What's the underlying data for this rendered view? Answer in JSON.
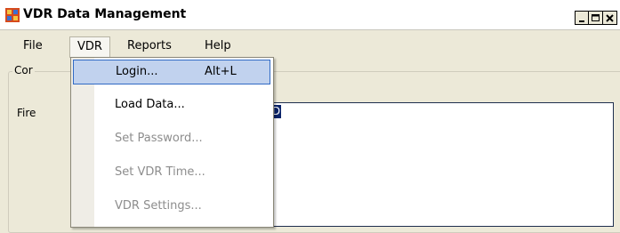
{
  "window": {
    "title": "VDR Data Management",
    "icon": "app-window-icon",
    "controls": [
      "minimize-icon",
      "maximize-icon",
      "close-icon"
    ]
  },
  "menubar": {
    "items": [
      {
        "label": "File"
      },
      {
        "label": "VDR",
        "open": true
      },
      {
        "label": "Reports"
      },
      {
        "label": "Help"
      }
    ]
  },
  "vdr_menu": {
    "items": [
      {
        "label": "Login...",
        "shortcut": "Alt+L",
        "enabled": true,
        "selected": true
      },
      {
        "label": "Load Data...",
        "enabled": true
      },
      {
        "label": "Set Password...",
        "enabled": false
      },
      {
        "label": "Set VDR Time...",
        "enabled": false
      },
      {
        "label": "VDR Settings...",
        "enabled": false
      }
    ]
  },
  "form": {
    "group_legend_partial": "Cor",
    "field_label_partial": "Fire",
    "textbox_visible_text": "RED"
  },
  "colors": {
    "window_bg": "#ece9d8",
    "menu_highlight_bg": "#c1d2ee",
    "menu_highlight_border": "#316ac5",
    "text_selection_bg": "#0b246a",
    "disabled_text": "#8d8d8d"
  }
}
